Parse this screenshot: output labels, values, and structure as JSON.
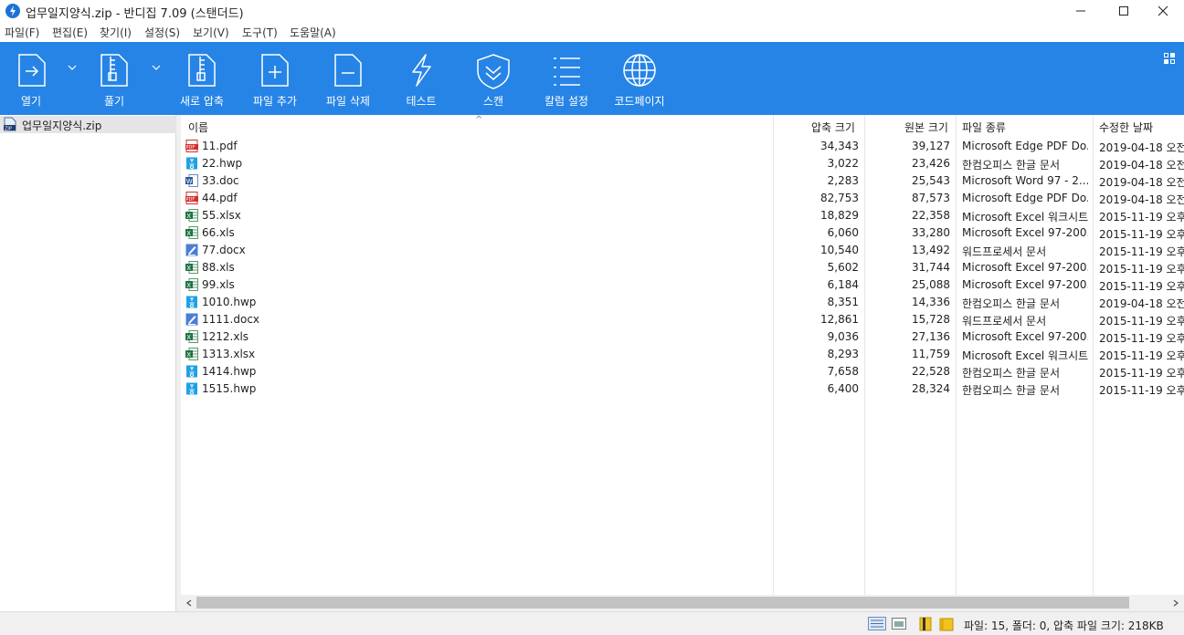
{
  "window": {
    "title": "업무일지양식.zip - 반디집 7.09 (스탠더드)"
  },
  "menu": [
    "파일(F)",
    "편집(E)",
    "찾기(I)",
    "설정(S)",
    "보기(V)",
    "도구(T)",
    "도움말(A)"
  ],
  "toolbar": {
    "open": "열기",
    "extract": "풀기",
    "new": "새로 압축",
    "add": "파일 추가",
    "delete": "파일 삭제",
    "test": "테스트",
    "scan": "스캔",
    "columns": "칼럼 설정",
    "codepage": "코드페이지"
  },
  "tree": {
    "root": "업무일지양식.zip"
  },
  "columns": {
    "name": "이름",
    "packed": "압축 크기",
    "original": "원본 크기",
    "type": "파일 종류",
    "modified": "수정한 날짜"
  },
  "files": [
    {
      "icon": "pdf-icon",
      "name": "11.pdf",
      "packed": "34,343",
      "original": "39,127",
      "type": "Microsoft Edge PDF Do...",
      "date": "2019-04-18 오전"
    },
    {
      "icon": "hwp-icon",
      "name": "22.hwp",
      "packed": "3,022",
      "original": "23,426",
      "type": "한컴오피스 한글 문서",
      "date": "2019-04-18 오전"
    },
    {
      "icon": "word-icon",
      "name": "33.doc",
      "packed": "2,283",
      "original": "25,543",
      "type": "Microsoft Word 97 - 2...",
      "date": "2019-04-18 오전"
    },
    {
      "icon": "pdf-icon",
      "name": "44.pdf",
      "packed": "82,753",
      "original": "87,573",
      "type": "Microsoft Edge PDF Do...",
      "date": "2019-04-18 오전"
    },
    {
      "icon": "excel-icon",
      "name": "55.xlsx",
      "packed": "18,829",
      "original": "22,358",
      "type": "Microsoft Excel 워크시트",
      "date": "2015-11-19 오후"
    },
    {
      "icon": "excel-icon",
      "name": "66.xls",
      "packed": "6,060",
      "original": "33,280",
      "type": "Microsoft Excel 97-200...",
      "date": "2015-11-19 오후"
    },
    {
      "icon": "wordpad-icon",
      "name": "77.docx",
      "packed": "10,540",
      "original": "13,492",
      "type": "워드프로세서 문서",
      "date": "2015-11-19 오후"
    },
    {
      "icon": "excel-icon",
      "name": "88.xls",
      "packed": "5,602",
      "original": "31,744",
      "type": "Microsoft Excel 97-200...",
      "date": "2015-11-19 오후"
    },
    {
      "icon": "excel-icon",
      "name": "99.xls",
      "packed": "6,184",
      "original": "25,088",
      "type": "Microsoft Excel 97-200...",
      "date": "2015-11-19 오후"
    },
    {
      "icon": "hwp-icon",
      "name": "1010.hwp",
      "packed": "8,351",
      "original": "14,336",
      "type": "한컴오피스 한글 문서",
      "date": "2019-04-18 오전"
    },
    {
      "icon": "wordpad-icon",
      "name": "1111.docx",
      "packed": "12,861",
      "original": "15,728",
      "type": "워드프로세서 문서",
      "date": "2015-11-19 오후"
    },
    {
      "icon": "excel-icon",
      "name": "1212.xls",
      "packed": "9,036",
      "original": "27,136",
      "type": "Microsoft Excel 97-200...",
      "date": "2015-11-19 오후"
    },
    {
      "icon": "excel-icon",
      "name": "1313.xlsx",
      "packed": "8,293",
      "original": "11,759",
      "type": "Microsoft Excel 워크시트",
      "date": "2015-11-19 오후"
    },
    {
      "icon": "hwp-icon",
      "name": "1414.hwp",
      "packed": "7,658",
      "original": "22,528",
      "type": "한컴오피스 한글 문서",
      "date": "2015-11-19 오후"
    },
    {
      "icon": "hwp-icon",
      "name": "1515.hwp",
      "packed": "6,400",
      "original": "28,324",
      "type": "한컴오피스 한글 문서",
      "date": "2015-11-19 오후"
    }
  ],
  "status": {
    "text": "파일: 15, 폴더: 0, 압축 파일 크기: 218KB"
  },
  "colors": {
    "toolbar": "#2684e6",
    "accent": "#1a73d6"
  }
}
